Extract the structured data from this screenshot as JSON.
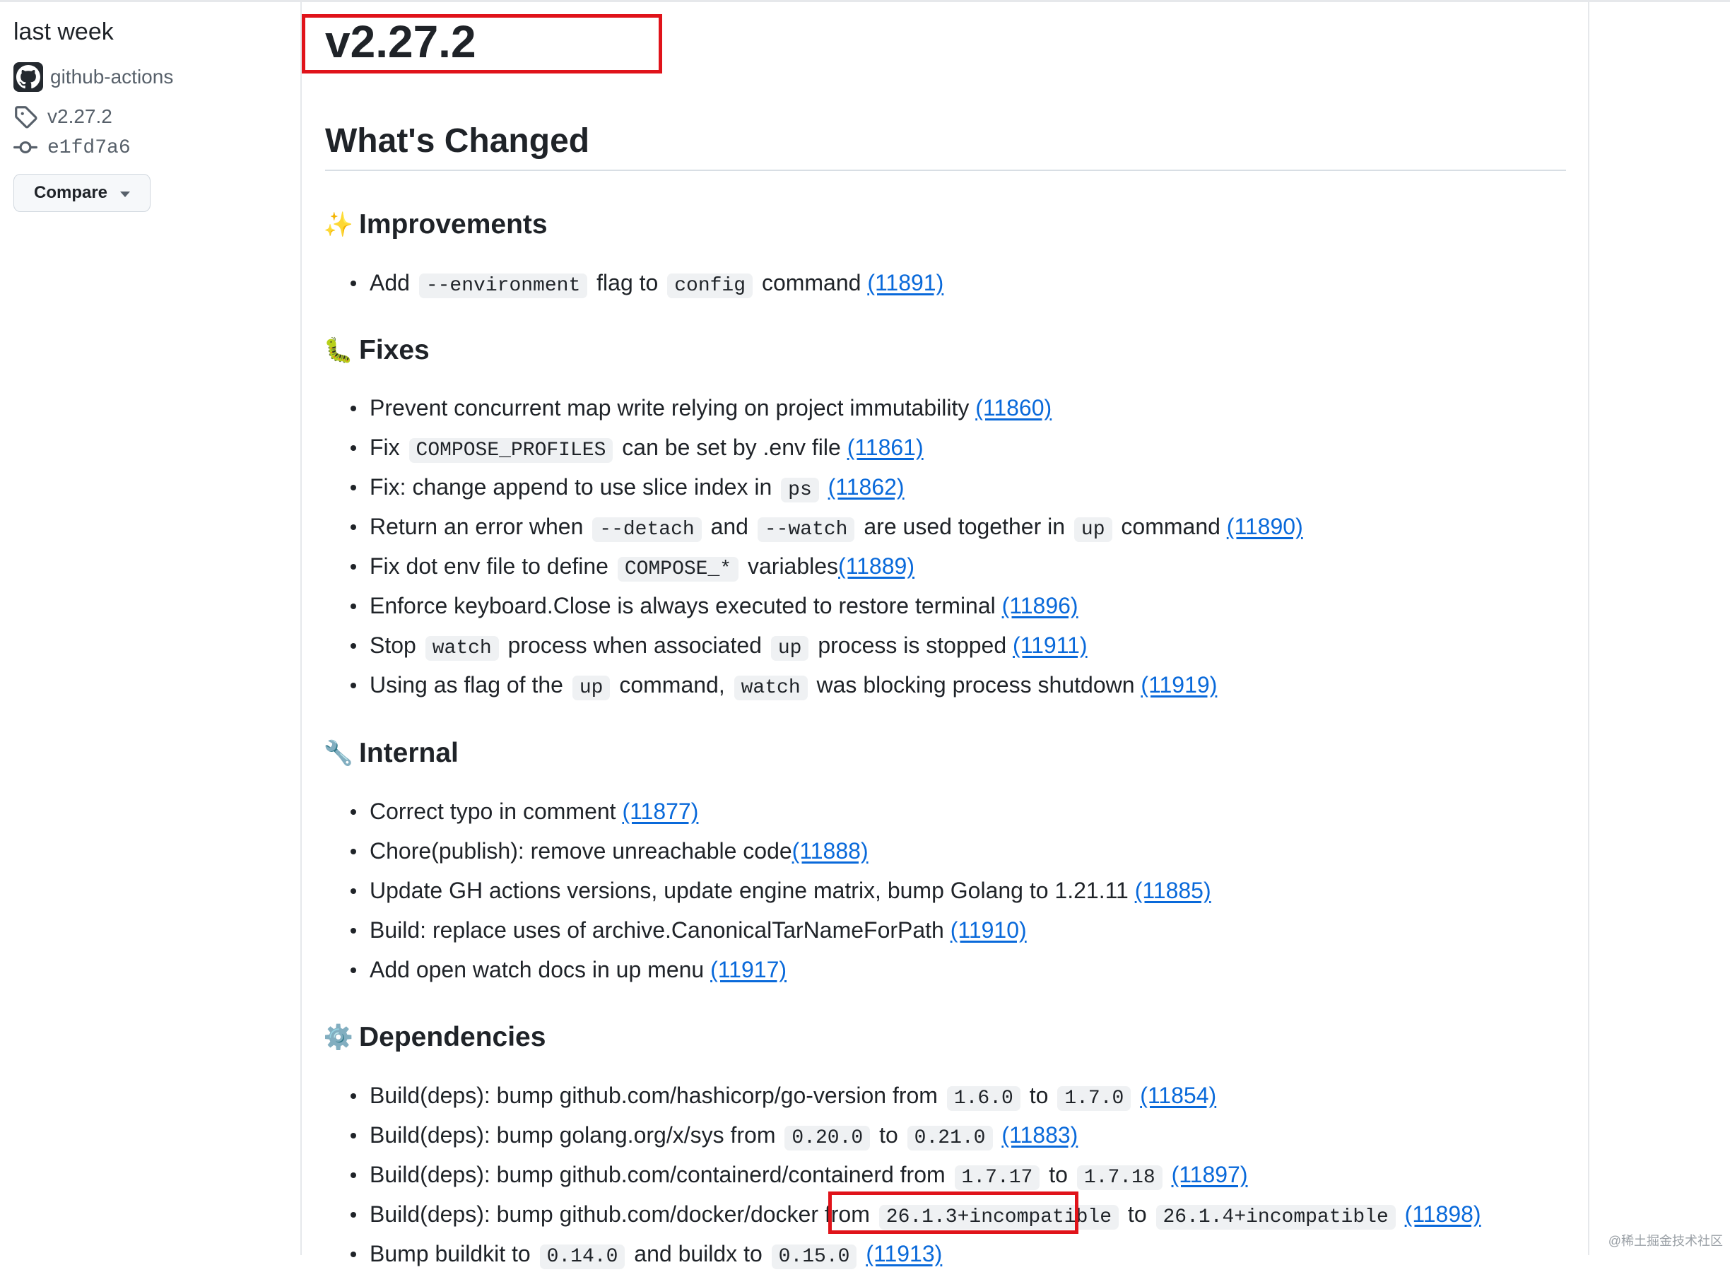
{
  "sidebar": {
    "time": "last week",
    "author": "github-actions",
    "tag": "v2.27.2",
    "commit": "e1fd7a6",
    "compare_label": "Compare"
  },
  "release": {
    "title": "v2.27.2",
    "section_title": "What's Changed"
  },
  "categories": [
    {
      "emoji": "✨",
      "title": "Improvements",
      "items": [
        [
          {
            "t": "Add "
          },
          {
            "c": "--environment"
          },
          {
            "t": " flag to "
          },
          {
            "c": "config"
          },
          {
            "t": " command "
          },
          {
            "l": "(11891)"
          }
        ]
      ]
    },
    {
      "emoji": "🐛",
      "title": "Fixes",
      "items": [
        [
          {
            "t": "Prevent concurrent map write relying on project immutability "
          },
          {
            "l": "(11860)"
          }
        ],
        [
          {
            "t": "Fix "
          },
          {
            "c": "COMPOSE_PROFILES"
          },
          {
            "t": " can be set by .env file "
          },
          {
            "l": "(11861)"
          }
        ],
        [
          {
            "t": "Fix: change append to use slice index in "
          },
          {
            "c": "ps"
          },
          {
            "t": " "
          },
          {
            "l": "(11862)"
          }
        ],
        [
          {
            "t": "Return an error when "
          },
          {
            "c": "--detach"
          },
          {
            "t": " and "
          },
          {
            "c": "--watch"
          },
          {
            "t": " are used together in "
          },
          {
            "c": "up"
          },
          {
            "t": " command "
          },
          {
            "l": "(11890)"
          }
        ],
        [
          {
            "t": "Fix dot env file to define "
          },
          {
            "c": "COMPOSE_*"
          },
          {
            "t": " variables"
          },
          {
            "l": "(11889)"
          }
        ],
        [
          {
            "t": "Enforce keyboard.Close is always executed to restore terminal "
          },
          {
            "l": "(11896)"
          }
        ],
        [
          {
            "t": "Stop "
          },
          {
            "c": "watch"
          },
          {
            "t": " process when associated "
          },
          {
            "c": "up"
          },
          {
            "t": " process is stopped "
          },
          {
            "l": "(11911)"
          }
        ],
        [
          {
            "t": "Using as flag of the "
          },
          {
            "c": "up"
          },
          {
            "t": " command, "
          },
          {
            "c": "watch"
          },
          {
            "t": " was blocking process shutdown "
          },
          {
            "l": "(11919)"
          }
        ]
      ]
    },
    {
      "emoji": "🔧",
      "title": "Internal",
      "items": [
        [
          {
            "t": "Correct typo in comment "
          },
          {
            "l": "(11877)"
          }
        ],
        [
          {
            "t": "Chore(publish): remove unreachable code"
          },
          {
            "l": "(11888)"
          }
        ],
        [
          {
            "t": "Update GH actions versions, update engine matrix, bump Golang to 1.21.11 "
          },
          {
            "l": "(11885)"
          }
        ],
        [
          {
            "t": "Build: replace uses of archive.CanonicalTarNameForPath "
          },
          {
            "l": "(11910)"
          }
        ],
        [
          {
            "t": "Add open watch docs in up menu "
          },
          {
            "l": "(11917)"
          }
        ]
      ]
    },
    {
      "emoji": "⚙️",
      "title": "Dependencies",
      "items": [
        [
          {
            "t": "Build(deps): bump github.com/hashicorp/go-version from "
          },
          {
            "c": "1.6.0"
          },
          {
            "t": " to "
          },
          {
            "c": "1.7.0"
          },
          {
            "t": " "
          },
          {
            "l": "(11854)"
          }
        ],
        [
          {
            "t": "Build(deps): bump golang.org/x/sys from "
          },
          {
            "c": "0.20.0"
          },
          {
            "t": " to "
          },
          {
            "c": "0.21.0"
          },
          {
            "t": " "
          },
          {
            "l": "(11883)"
          }
        ],
        [
          {
            "t": "Build(deps): bump github.com/containerd/containerd from "
          },
          {
            "c": "1.7.17"
          },
          {
            "t": " to "
          },
          {
            "c": "1.7.18"
          },
          {
            "t": " "
          },
          {
            "l": "(11897)"
          }
        ],
        [
          {
            "t": "Build(deps): bump github.com/docker/docker from "
          },
          {
            "c": "26.1.3+incompatible"
          },
          {
            "t": " to "
          },
          {
            "c": "26.1.4+incompatible"
          },
          {
            "t": " "
          },
          {
            "l": "(11898)"
          }
        ],
        [
          {
            "t": "Bump buildkit to "
          },
          {
            "c": "0.14.0"
          },
          {
            "t": " and buildx to "
          },
          {
            "c": "0.15.0"
          },
          {
            "t": " "
          },
          {
            "l": "(11913)"
          }
        ]
      ]
    }
  ],
  "watermark": "@稀土掘金技术社区"
}
